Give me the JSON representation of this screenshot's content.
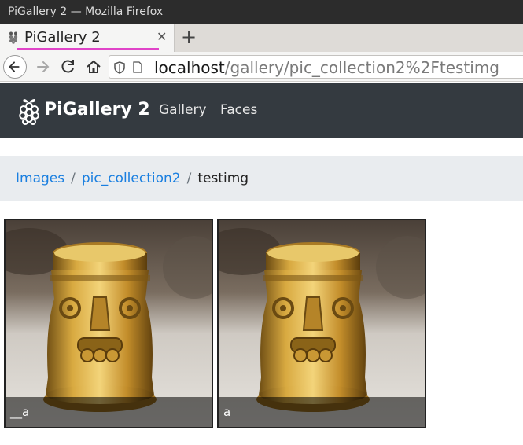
{
  "window": {
    "title": "PiGallery 2 — Mozilla Firefox"
  },
  "tabs": [
    {
      "label": "PiGallery 2",
      "close_icon": "close-icon"
    }
  ],
  "new_tab_label": "+",
  "url": {
    "host": "localhost",
    "path": "/gallery/pic_collection2%2Ftestimg"
  },
  "app": {
    "brand": "PiGallery 2",
    "nav": [
      {
        "label": "Gallery"
      },
      {
        "label": "Faces"
      }
    ]
  },
  "breadcrumb": {
    "items": [
      {
        "label": "Images"
      },
      {
        "label": "pic_collection2"
      }
    ],
    "separator": "/",
    "current": "testimg"
  },
  "photos": [
    {
      "caption": "__a"
    },
    {
      "caption": "a"
    }
  ],
  "colors": {
    "navbar": "#343a40",
    "breadcrumb_bg": "#e9ecef",
    "link": "#1a7fe0",
    "tab_accent": "#e044c8"
  }
}
